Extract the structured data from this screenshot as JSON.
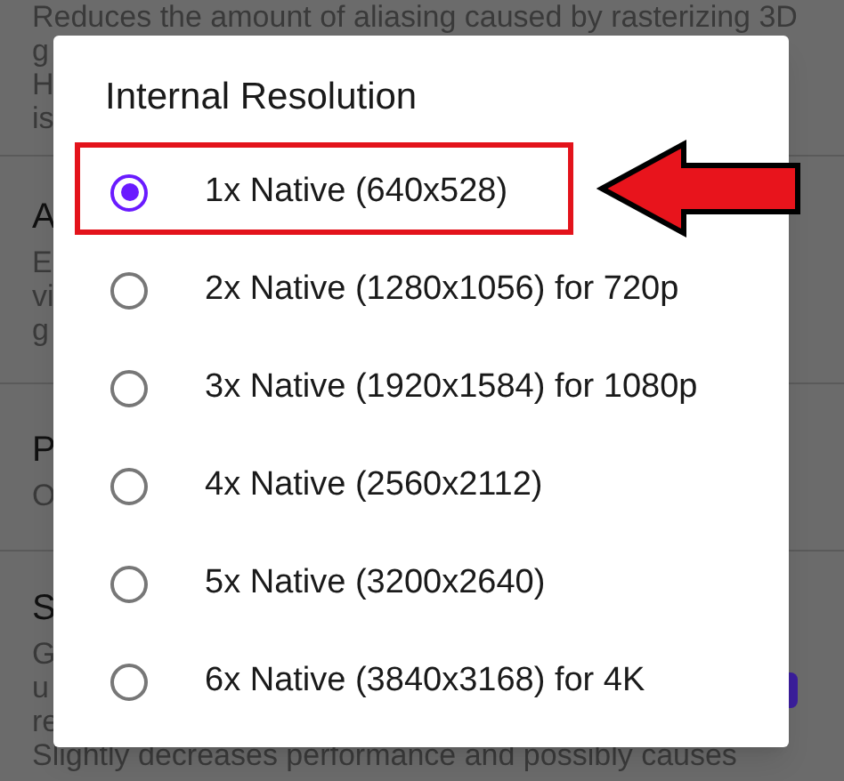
{
  "settings": {
    "sections": [
      {
        "lines": [
          {
            "kind": "text",
            "text": "Reduces the amount of aliasing caused by rasterizing 3D"
          },
          {
            "kind": "text",
            "text": "g"
          },
          {
            "kind": "text",
            "text": "H"
          },
          {
            "kind": "text",
            "text": "is"
          }
        ]
      },
      {
        "lines": [
          {
            "kind": "title",
            "text": "A"
          },
          {
            "kind": "text",
            "text": "E"
          },
          {
            "kind": "text",
            "text": "vi"
          },
          {
            "kind": "text",
            "text": "g"
          }
        ]
      },
      {
        "lines": [
          {
            "kind": "title",
            "text": "P"
          },
          {
            "kind": "text",
            "text": "O"
          }
        ]
      },
      {
        "lines": [
          {
            "kind": "title",
            "text": "S"
          },
          {
            "kind": "text",
            "text": "G"
          },
          {
            "kind": "text",
            "text": "u"
          },
          {
            "kind": "text",
            "text": "re"
          },
          {
            "kind": "text",
            "text": "Slightly decreases performance and possibly causes"
          }
        ]
      }
    ]
  },
  "dialog": {
    "title": "Internal Resolution",
    "options": [
      {
        "label": "1x Native (640x528)",
        "selected": true
      },
      {
        "label": "2x Native (1280x1056) for 720p",
        "selected": false
      },
      {
        "label": "3x Native (1920x1584) for 1080p",
        "selected": false
      },
      {
        "label": "4x Native (2560x2112)",
        "selected": false
      },
      {
        "label": "5x Native (3200x2640)",
        "selected": false
      },
      {
        "label": "6x Native (3840x3168) for 4K",
        "selected": false
      }
    ]
  }
}
